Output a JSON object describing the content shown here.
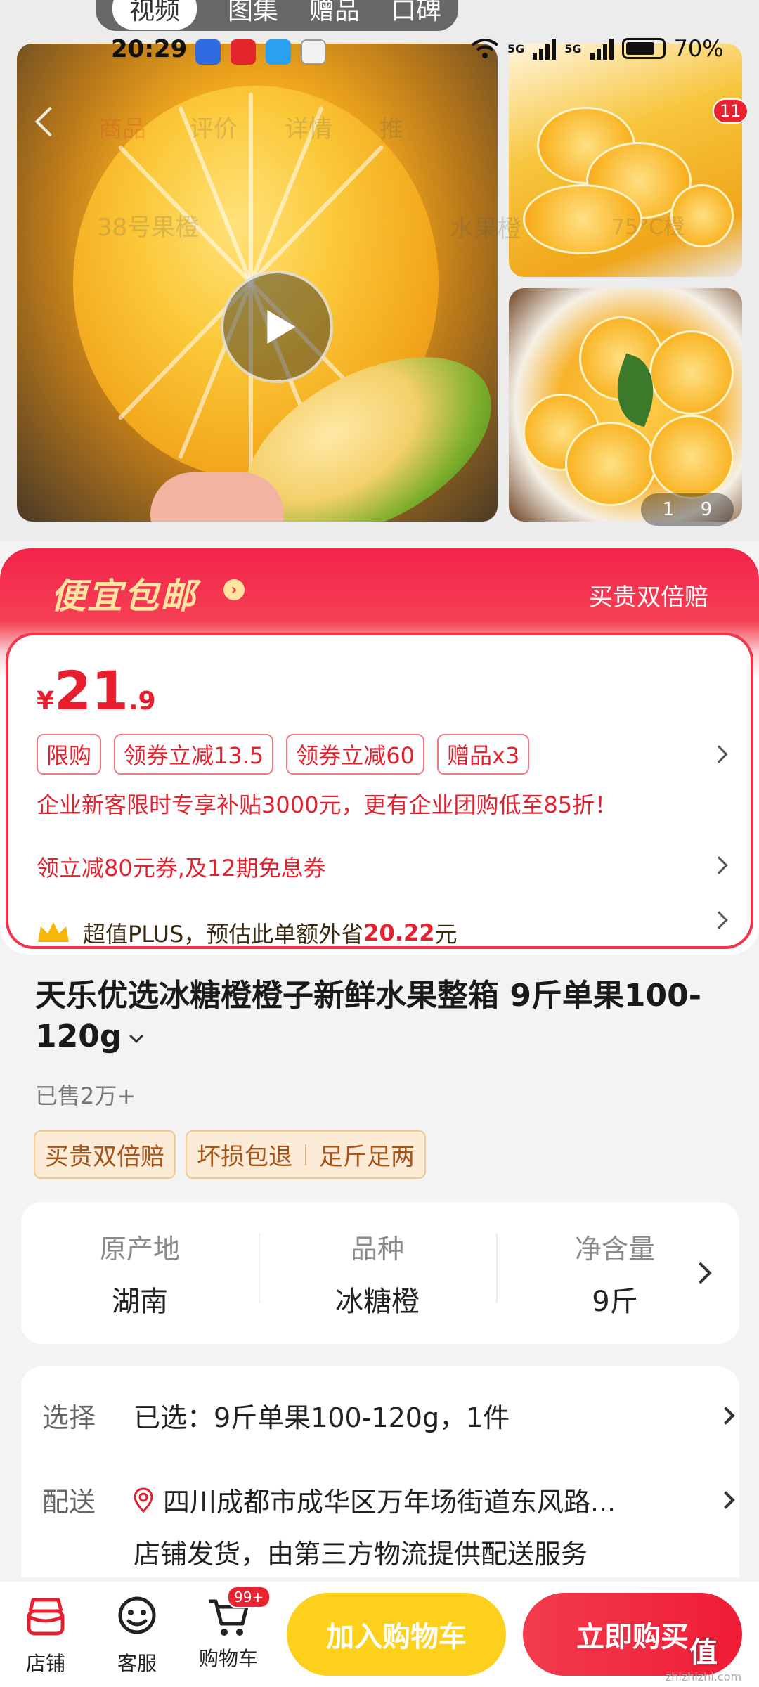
{
  "status_bar": {
    "time": "20:29",
    "battery": "70%",
    "net1": "5G",
    "net2": "5G"
  },
  "top_tabs": [
    "视频",
    "图集",
    "赠品",
    "口碑"
  ],
  "ghost_nav": {
    "tabs": [
      "商品",
      "评价",
      "详情",
      "推"
    ],
    "search": "38号果橙",
    "search_hint": "水果橙",
    "search_hint2": "75°C橙"
  },
  "gallery": {
    "badge_count": "11",
    "pager_current": "1",
    "pager_total": "9"
  },
  "promo": {
    "title": "便宜包邮",
    "right_text": "买贵双倍赔",
    "currency": "¥",
    "price_int": "21",
    "price_dec": ".9",
    "tags": [
      "限购",
      "领券立减13.5",
      "领券立减60",
      "赠品x3"
    ],
    "enterprise_line": "企业新客限时专享补贴3000元，更有企业团购低至85折！",
    "coupon_line": "领立减80元券,及12期免息券",
    "plus_text": "超值PLUS，预估此单额外省",
    "plus_amount": "20.22",
    "plus_unit": "元"
  },
  "product": {
    "title": "天乐优选冰糖橙橙子新鲜水果整箱 9斤单果100-120g",
    "sold": "已售2万+",
    "badges": [
      "买贵双倍赔",
      "坏损包退",
      "足斤足两"
    ]
  },
  "attributes": [
    {
      "key": "原产地",
      "value": "湖南"
    },
    {
      "key": "品种",
      "value": "冰糖橙"
    },
    {
      "key": "净含量",
      "value": "9斤"
    }
  ],
  "selection": {
    "select_label": "选择",
    "select_value": "已选：9斤单果100-120g，1件",
    "ship_label": "配送",
    "ship_address": "四川成都市成华区万年场街道东风路...",
    "ship_note": "店铺发货，由第三方物流提供配送服务"
  },
  "bottom_bar": {
    "store": "店铺",
    "service": "客服",
    "cart": "购物车",
    "cart_badge": "99+",
    "add_to_cart": "加入购物车",
    "buy_now": "立即购买"
  },
  "watermark": {
    "main": "值",
    "sub": "zhizhizhi.com"
  },
  "colors": {
    "brand_red": "#e61e2e",
    "cart_yellow": "#fdd11b",
    "promo_gold": "#ffe3a0"
  }
}
